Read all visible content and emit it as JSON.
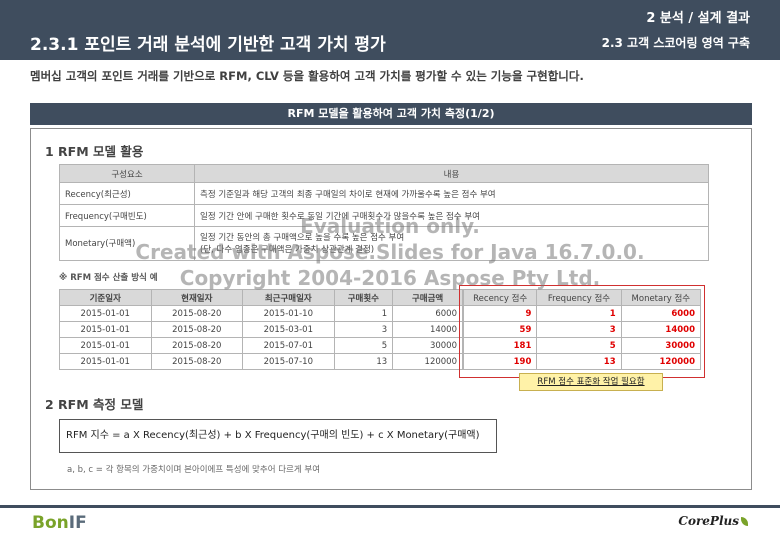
{
  "header": {
    "top_right": "2 분석 / 설계 결과",
    "title": "2.3.1 포인트 거래 분석에 기반한 고객 가치 평가",
    "subtitle": "2.3 고객 스코어링 영역 구축"
  },
  "intro": "멤버십 고객의 포인트 거래를 기반으로 RFM, CLV 등을 활용하여 고객 가치를 평가할 수 있는 기능을 구현합니다.",
  "banner": "RFM 모델을 활용하여 고객 가치 측정(1/2)",
  "section1": {
    "title": "1 RFM 모델 활용",
    "columns": [
      "구성요소",
      "내용"
    ],
    "rows": [
      {
        "component": "Recency(최근성)",
        "content": "측정 기준일과 해당 고객의 최종 구매일의 차이로 현재에 가까울수록 높은 점수 부여",
        "content2": ""
      },
      {
        "component": "Frequency(구매빈도)",
        "content": "일정 기간 안에 구매한 횟수로 동일 기간에 구매횟수가 많을수록 높은 점수 부여",
        "content2": ""
      },
      {
        "component": "Monetary(구매액)",
        "content": "일정 기간 동안의 총 구매액으로 높을 수록 높은 점수 부여",
        "content2": "(단, 다수 업종은 구매액은 가중치 상관관계 결정)"
      }
    ],
    "note": "※ RFM 점수 산출 방식 예",
    "calc_columns": [
      "기준일자",
      "현재일자",
      "최근구매일자",
      "구매횟수",
      "구매금액"
    ],
    "calc_rows": [
      [
        "2015-01-01",
        "2015-08-20",
        "2015-01-10",
        "1",
        "6000"
      ],
      [
        "2015-01-01",
        "2015-08-20",
        "2015-03-01",
        "3",
        "14000"
      ],
      [
        "2015-01-01",
        "2015-08-20",
        "2015-07-01",
        "5",
        "30000"
      ],
      [
        "2015-01-01",
        "2015-08-20",
        "2015-07-10",
        "13",
        "120000"
      ]
    ],
    "score_columns": [
      "Recency 점수",
      "Frequency 점수",
      "Monetary 점수"
    ],
    "score_rows": [
      [
        "9",
        "1",
        "6000"
      ],
      [
        "59",
        "3",
        "14000"
      ],
      [
        "181",
        "5",
        "30000"
      ],
      [
        "190",
        "13",
        "120000"
      ]
    ],
    "callout": "RFM 점수 표준화 작업 필요함"
  },
  "section2": {
    "title": "2 RFM 측정 모델",
    "formula": "RFM 지수 = a X Recency(최근성) + b X Frequency(구매의 빈도) + c X Monetary(구매액)",
    "formula_note": "a, b, c = 각 항목의 가중치이며 본아이에프 특성에 맞추어 다르게 부여"
  },
  "watermark": {
    "line1": "Evaluation only.",
    "line2": "Created with Aspose.Slides for Java 16.7.0.0.",
    "line3": "Copyright 2004-2016 Aspose Pty Ltd."
  },
  "footer": {
    "logo_left_a": "Bon",
    "logo_left_b": "IF",
    "logo_right": "CorePlus"
  }
}
